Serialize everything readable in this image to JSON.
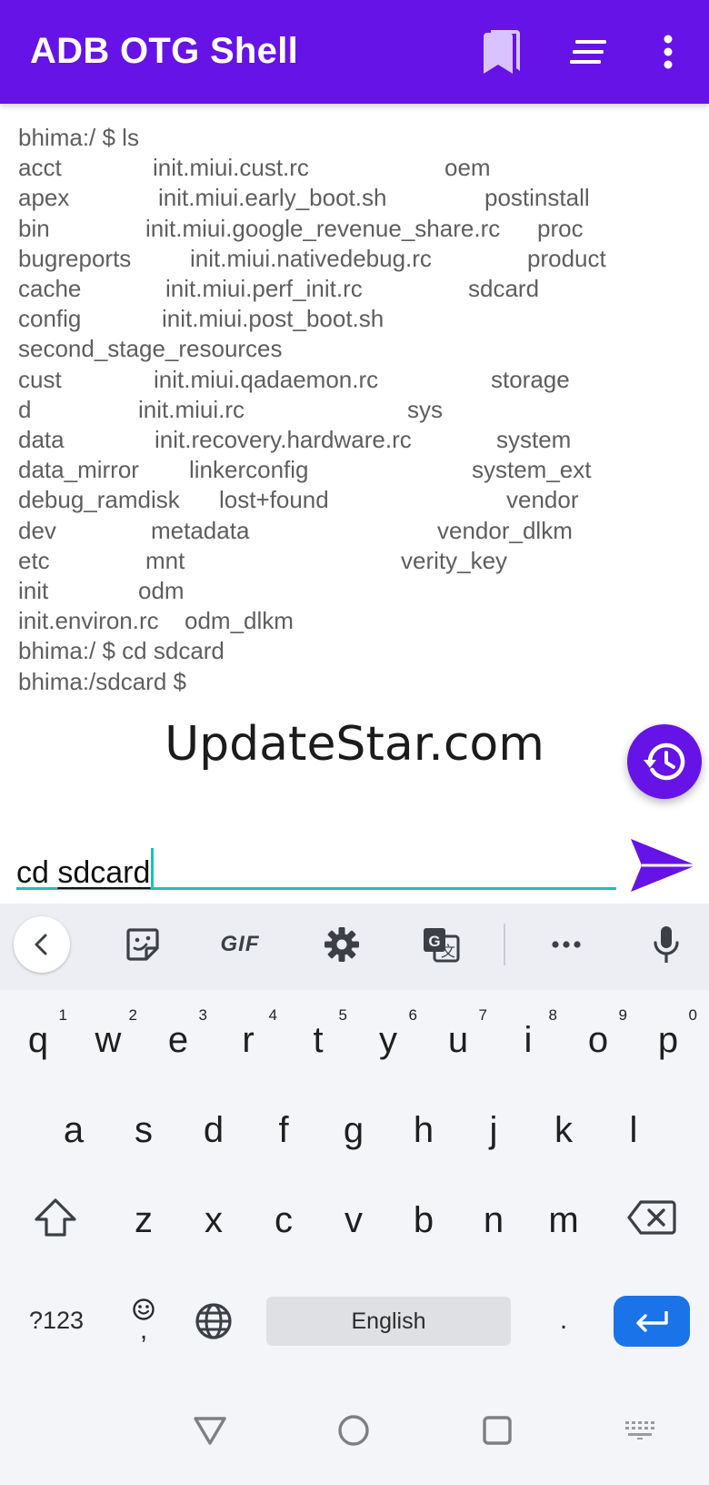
{
  "app": {
    "title": "ADB OTG Shell",
    "accent_color": "#6513e6",
    "actions": [
      {
        "icon": "bookmarks-icon"
      },
      {
        "icon": "notes-icon"
      },
      {
        "icon": "more-vert-icon"
      }
    ]
  },
  "terminal": {
    "text_color": "#5e5e5e",
    "lines": [
      [
        "bhima:/ $ ls"
      ],
      [
        "acct",
        "init.miui.cust.rc",
        "oem"
      ],
      [
        "apex",
        "init.miui.early_boot.sh",
        "postinstall"
      ],
      [
        "bin",
        "init.miui.google_revenue_share.rc",
        "proc"
      ],
      [
        "bugreports",
        "init.miui.nativedebug.rc",
        "product"
      ],
      [
        "cache",
        "init.miui.perf_init.rc",
        "sdcard"
      ],
      [
        "config",
        "init.miui.post_boot.sh"
      ],
      [
        "second_stage_resources"
      ],
      [
        "cust",
        "init.miui.qadaemon.rc",
        "storage"
      ],
      [
        "d",
        "init.miui.rc",
        "sys"
      ],
      [
        "data",
        "init.recovery.hardware.rc",
        "system"
      ],
      [
        "data_mirror",
        "linkerconfig",
        "system_ext"
      ],
      [
        "debug_ramdisk",
        "lost+found",
        "vendor"
      ],
      [
        "dev",
        "metadata",
        "vendor_dlkm"
      ],
      [
        "etc",
        "mnt",
        "verity_key"
      ],
      [
        "init",
        "odm"
      ],
      [
        "init.environ.rc",
        "odm_dlkm"
      ],
      [
        "bhima:/ $ cd sdcard"
      ],
      [
        "bhima:/sdcard $"
      ]
    ]
  },
  "watermark": "UpdateStar.com",
  "history_button": {
    "icon": "history-icon"
  },
  "command": {
    "prefix": "cd ",
    "word": "sdcard",
    "send_icon": "send-icon",
    "underline_color": "#21c1b3"
  },
  "keyboard": {
    "toolbar": {
      "back_icon": "chevron-left-icon",
      "sticker_icon": "sticker-icon",
      "gif_label": "GIF",
      "settings_icon": "gear-icon",
      "translate_icon": "translate-icon",
      "more_icon": "more-horiz-icon",
      "mic_icon": "mic-icon"
    },
    "row1": [
      {
        "key": "q",
        "hint": "1"
      },
      {
        "key": "w",
        "hint": "2"
      },
      {
        "key": "e",
        "hint": "3"
      },
      {
        "key": "r",
        "hint": "4"
      },
      {
        "key": "t",
        "hint": "5"
      },
      {
        "key": "y",
        "hint": "6"
      },
      {
        "key": "u",
        "hint": "7"
      },
      {
        "key": "i",
        "hint": "8"
      },
      {
        "key": "o",
        "hint": "9"
      },
      {
        "key": "p",
        "hint": "0"
      }
    ],
    "row2": [
      "a",
      "s",
      "d",
      "f",
      "g",
      "h",
      "j",
      "k",
      "l"
    ],
    "row3": [
      "z",
      "x",
      "c",
      "v",
      "b",
      "n",
      "m"
    ],
    "shift_icon": "shift-icon",
    "backspace_icon": "backspace-icon",
    "symbols_label": "?123",
    "emoji_key": {
      "icon": "emoji-icon",
      "label": ","
    },
    "globe_icon": "globe-icon",
    "space_label": "English",
    "period_label": ".",
    "enter_icon": "enter-icon",
    "enter_color": "#1a73e8"
  },
  "navbar": {
    "back_icon": "nav-back-icon",
    "home_icon": "nav-home-icon",
    "recents_icon": "nav-recents-icon",
    "keyboard_icon": "keyboard-hide-icon"
  }
}
